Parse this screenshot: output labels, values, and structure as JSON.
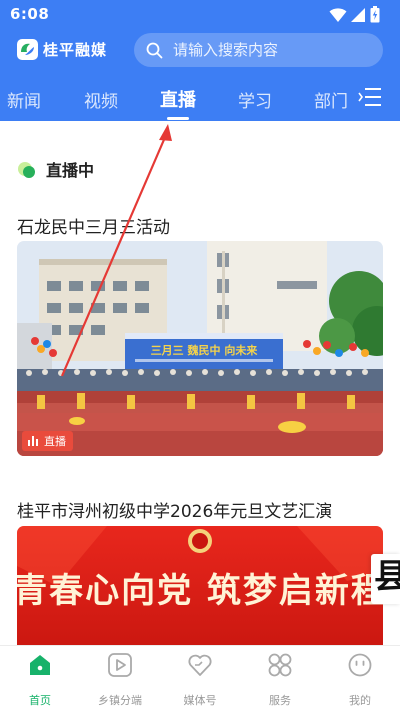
{
  "status_bar": {
    "time": "6:08"
  },
  "header": {
    "app_name": "桂平融媒",
    "search_placeholder": "请输入搜索内容",
    "tabs": [
      {
        "label": "新闻",
        "active": false
      },
      {
        "label": "视频",
        "active": false
      },
      {
        "label": "直播",
        "active": true
      },
      {
        "label": "学习",
        "active": false
      },
      {
        "label": "部门",
        "active": false
      }
    ],
    "accent_color": "#3d7ef4"
  },
  "live_section": {
    "title": "直播中"
  },
  "cards": [
    {
      "title": "石龙民中三月三活动",
      "badge": "直播",
      "banner": "三月三 魏民中 向未来"
    },
    {
      "title": "桂平市浔州初级中学2026年元旦文艺汇演",
      "banner": "青春心向党 筑梦启新程"
    }
  ],
  "side_peek_text": "县",
  "bottom_nav": [
    {
      "label": "首页",
      "icon": "home-icon",
      "active": true
    },
    {
      "label": "乡镇分端",
      "icon": "play-square-icon",
      "active": false
    },
    {
      "label": "媒体号",
      "icon": "heart-icon",
      "active": false
    },
    {
      "label": "服务",
      "icon": "grid-icon",
      "active": false
    },
    {
      "label": "我的",
      "icon": "smile-icon",
      "active": false
    }
  ],
  "colors": {
    "active_nav": "#17b26a",
    "live_badge": "#e94b3c",
    "annotation_arrow": "#e53935"
  }
}
